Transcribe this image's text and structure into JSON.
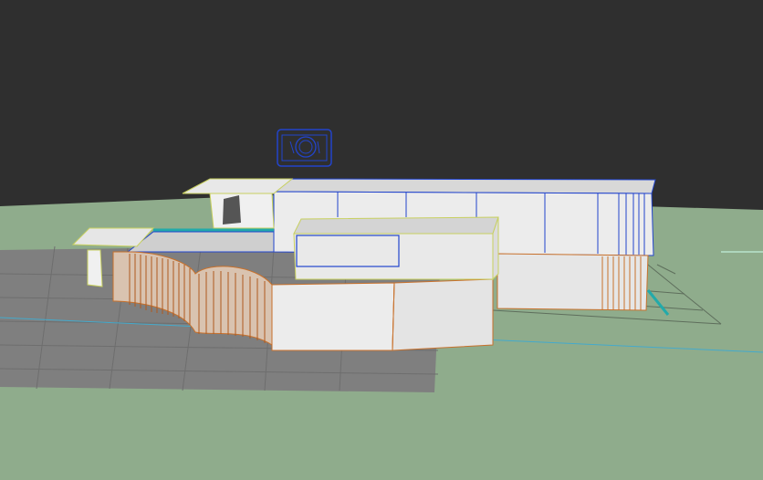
{
  "viewport": {
    "background_color": "#2f2f2f",
    "ground_color": "#8fac8c",
    "shadow_color": "#7d7d7d",
    "icon": "camera-icon",
    "model_wire_colors": {
      "primary": "#2244cc",
      "secondary": "#c8712c",
      "accent": "#c8d060"
    }
  }
}
